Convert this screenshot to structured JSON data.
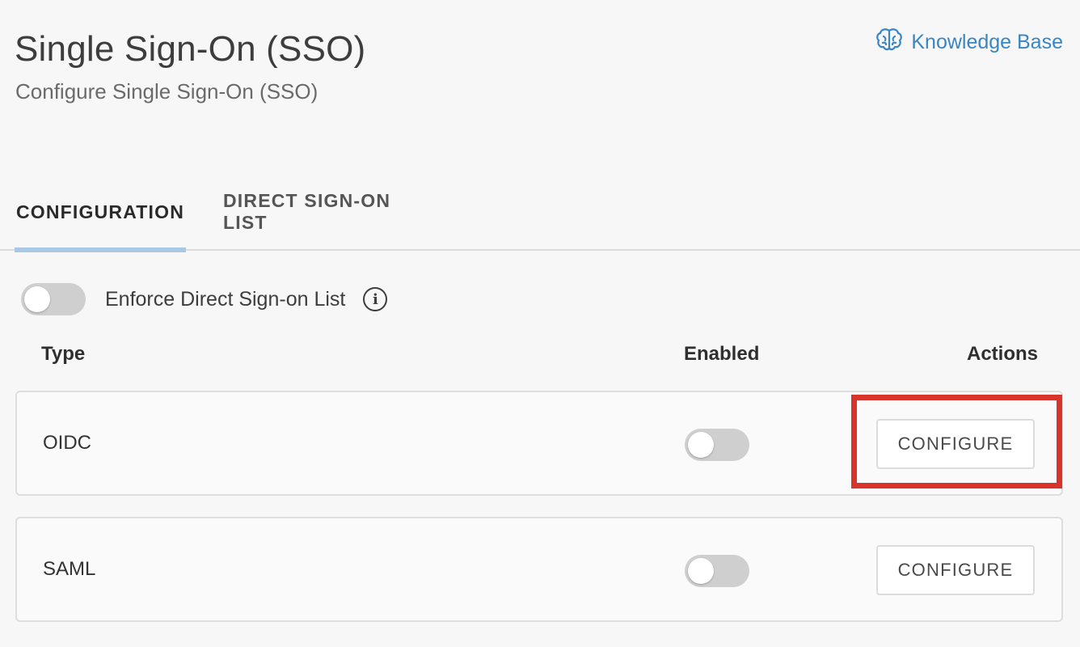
{
  "header": {
    "title": "Single Sign-On (SSO)",
    "subtitle": "Configure Single Sign-On (SSO)",
    "knowledge_base_label": "Knowledge Base",
    "knowledge_base_icon": "brain-icon"
  },
  "tabs": [
    {
      "label": "CONFIGURATION",
      "active": true
    },
    {
      "label": "DIRECT SIGN-ON LIST",
      "active": false
    }
  ],
  "enforce": {
    "label": "Enforce Direct Sign-on List",
    "enabled": false,
    "info_icon": "info-icon",
    "info_glyph": "i"
  },
  "table": {
    "headers": {
      "type": "Type",
      "enabled": "Enabled",
      "actions": "Actions"
    },
    "rows": [
      {
        "type": "OIDC",
        "enabled": false,
        "action_label": "CONFIGURE"
      },
      {
        "type": "SAML",
        "enabled": false,
        "action_label": "CONFIGURE"
      }
    ]
  },
  "colors": {
    "link": "#3a86c2",
    "active_tab_underline": "#a9c8e3",
    "highlight": "#d9342b",
    "toggle_off": "#cfcfcf"
  }
}
